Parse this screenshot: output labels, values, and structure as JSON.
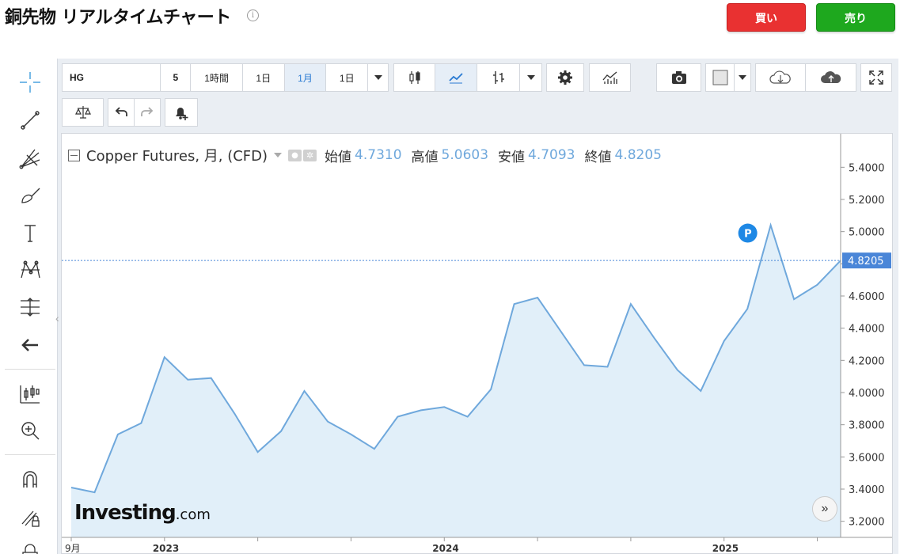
{
  "header": {
    "title": "銅先物 リアルタイムチャート",
    "info_icon": "info-icon",
    "buy_label": "買い",
    "sell_label": "売り",
    "buy_color": "#e93131",
    "sell_color": "#1ea81e"
  },
  "toolbar": {
    "symbol": "HG",
    "intervals": [
      "5",
      "1時間",
      "1日",
      "1月",
      "1日"
    ],
    "active_interval": "1月",
    "icons": [
      "candlestick-icon",
      "line-chart-icon",
      "bar-chart-icon",
      "settings-icon",
      "indicators-icon",
      "camera-icon",
      "color-box-icon",
      "cloud-download-icon",
      "cloud-upload-icon",
      "fullscreen-icon",
      "compare-icon",
      "undo-icon",
      "redo-icon",
      "alert-icon"
    ]
  },
  "legend": {
    "name": "Copper Futures, 月, (CFD)",
    "open_label": "始値",
    "open": "4.7310",
    "high_label": "高値",
    "high": "5.0603",
    "low_label": "安値",
    "low": "4.7093",
    "close_label": "終値",
    "close": "4.8205"
  },
  "logo": {
    "brand": "Investing",
    "suffix": ".com"
  },
  "colors": {
    "line": "#6fa8dc",
    "area_fill": "#e1eff9",
    "price_badge": "#4a86d8"
  },
  "chart_data": {
    "type": "area",
    "title": "Copper Futures, 月, (CFD)",
    "x": [
      "2022-09",
      "2022-10",
      "2022-11",
      "2022-12",
      "2023-01",
      "2023-02",
      "2023-03",
      "2023-04",
      "2023-05",
      "2023-06",
      "2023-07",
      "2023-08",
      "2023-09",
      "2023-10",
      "2023-11",
      "2023-12",
      "2024-01",
      "2024-02",
      "2024-03",
      "2024-04",
      "2024-05",
      "2024-06",
      "2024-07",
      "2024-08",
      "2024-09",
      "2024-10",
      "2024-11",
      "2024-12",
      "2025-01",
      "2025-02",
      "2025-03",
      "2025-04",
      "2025-05",
      "2025-06"
    ],
    "values": [
      3.41,
      3.38,
      3.74,
      3.81,
      4.22,
      4.08,
      4.09,
      3.87,
      3.63,
      3.76,
      4.01,
      3.82,
      3.74,
      3.65,
      3.85,
      3.89,
      3.91,
      3.85,
      4.02,
      4.55,
      4.59,
      4.38,
      4.17,
      4.16,
      4.55,
      4.34,
      4.14,
      4.01,
      4.32,
      4.52,
      5.04,
      4.58,
      4.67,
      4.8205
    ],
    "xtick_labels": [
      "9月",
      "2023",
      "2024",
      "2025"
    ],
    "yticks": [
      3.2,
      3.4,
      3.6,
      3.8,
      4.0,
      4.2,
      4.4,
      4.6,
      4.8,
      5.0,
      5.2,
      5.4
    ],
    "ytick_labels": [
      "3.2000",
      "3.4000",
      "3.6000",
      "3.8000",
      "4.0000",
      "4.2000",
      "4.4000",
      "4.6000",
      "4.8000",
      "5.0000",
      "5.2000",
      "5.4000"
    ],
    "ylim": [
      3.1,
      5.5
    ],
    "last_price": 4.8205,
    "last_price_label": "4.8205",
    "annotation": "P",
    "grid": false
  }
}
